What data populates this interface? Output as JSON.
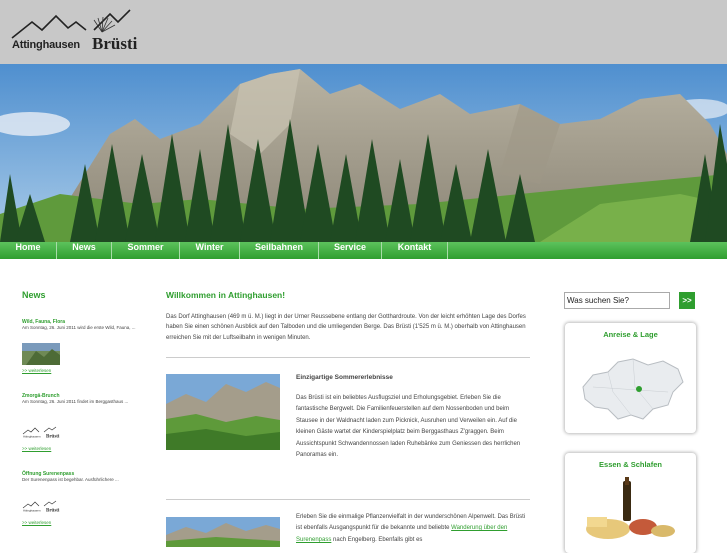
{
  "logo": {
    "place": "Attinghausen",
    "mountain": "Brüsti"
  },
  "nav": {
    "items": [
      "Home",
      "News",
      "Sommer",
      "Winter",
      "Seilbahnen",
      "Service",
      "Kontakt"
    ]
  },
  "sidebar": {
    "heading": "News",
    "items": [
      {
        "title": "Wild, Fauna, Flora",
        "text": "Am Sonntag, 26. Juni 2011 wird die erste Wild, Fauna, ...",
        "link": ">> weiterlesen"
      },
      {
        "title": "Zmorgä-Brunch",
        "text": "Am Sonntag, 26. Juni 2011 findet im Berggasthaus ...",
        "link": ">> weiterlesen"
      },
      {
        "title": "Öffnung Surenenpass",
        "text": "Der Surenenpass ist begehbar. Ausführlichere ...",
        "link": ">> weiterlesen"
      }
    ]
  },
  "main": {
    "title": "Willkommen in Attinghausen!",
    "intro": "Das Dorf Attinghausen (469 m ü. M.) liegt in der Urner Reussebene entlang der Gotthardroute. Von der leicht erhöhten Lage des Dorfes haben Sie einen schönen Ausblick auf den Talboden und die umliegenden Berge. Das Brüsti (1'525 m ü. M.) oberhalb von Attinghausen erreichen Sie mit der Luftseilbahn in wenigen Minuten.",
    "section1": {
      "title": "Einzigartige Sommererlebnisse",
      "text": "Das Brüsti ist ein beliebtes Ausflugsziel und Erholungsgebiet. Erleben Sie die fantastische Bergwelt. Die Familienfeuerstellen auf dem Nossenboden und beim Stausee in der Waldnacht laden zum Picknick, Ausruhen und Verweilen ein. Auf die kleinen Gäste wartet der Kinderspielplatz beim Berggasthaus Z'graggen. Beim Aussichtspunkt Schwandennossen laden Ruhebänke zum Geniessen des herrlichen Panoramas ein."
    },
    "section2": {
      "text_before": "Erleben Sie die einmalige Pflanzenvielfalt in der wunderschönen Alpenwelt. Das Brüsti ist ebenfalls Ausgangspunkt für die bekannte und beliebte",
      "link": "Wanderung über den Surenenpass",
      "text_after": "nach Engelberg. Ebenfalls gibt es"
    }
  },
  "search": {
    "placeholder": "Was suchen Sie?",
    "button": ">>"
  },
  "right": {
    "box1_title": "Anreise & Lage",
    "box2_title": "Essen & Schlafen"
  },
  "colors": {
    "accent": "#2f9e2f",
    "header_bg": "#c8c8c8"
  }
}
